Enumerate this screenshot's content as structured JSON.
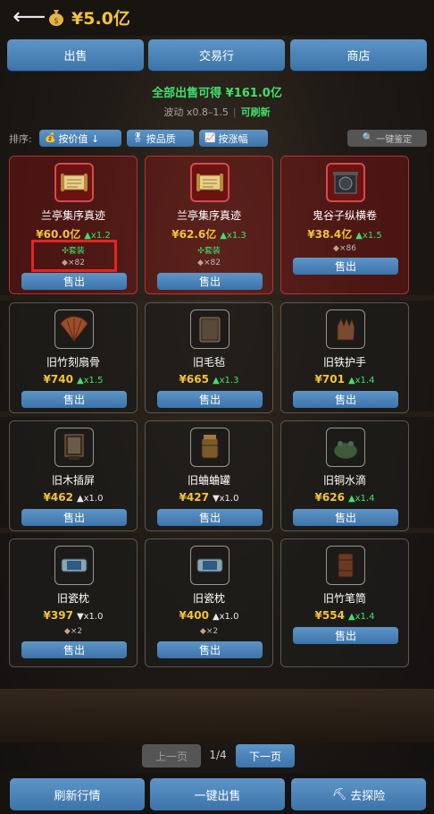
{
  "header": {
    "back_icon": "arrow-left-icon",
    "money_icon": "money-bag-icon",
    "money": "¥5.0亿"
  },
  "tabs": [
    {
      "label": "出售"
    },
    {
      "label": "交易行"
    },
    {
      "label": "商店"
    }
  ],
  "summary": {
    "total": "全部出售可得 ¥161.0亿",
    "fluct": "波动 x0.8–1.5",
    "sep": "|",
    "refresh": "可刷新"
  },
  "sort": {
    "label": "排序:",
    "buttons": [
      {
        "icon": "money-bag-icon",
        "label": "按价值 ↓"
      },
      {
        "icon": "medal-icon",
        "label": "按品质"
      },
      {
        "icon": "trend-chart-icon",
        "label": "按涨幅"
      }
    ],
    "appraise": {
      "icon": "search-icon",
      "label": "一键鉴定"
    }
  },
  "items": [
    {
      "name": "兰亭集序真迹",
      "price": "¥60.0亿",
      "trend": "▲x1.2",
      "dir": "up",
      "set": "套装",
      "count": "×82",
      "style": "red",
      "icon": "scroll"
    },
    {
      "name": "兰亭集序真迹",
      "price": "¥62.6亿",
      "trend": "▲x1.3",
      "dir": "up",
      "set": "套装",
      "count": "×82",
      "style": "red",
      "icon": "scroll"
    },
    {
      "name": "鬼谷子纵横卷",
      "price": "¥38.4亿",
      "trend": "▲x1.5",
      "dir": "up",
      "set": "",
      "count": "×86",
      "style": "red",
      "icon": "dark-scroll"
    },
    {
      "name": "旧竹刻扇骨",
      "price": "¥740",
      "trend": "▲x1.5",
      "dir": "up",
      "set": "",
      "count": "",
      "style": "dark",
      "icon": "fan"
    },
    {
      "name": "旧毛毡",
      "price": "¥665",
      "trend": "▲x1.3",
      "dir": "up",
      "set": "",
      "count": "",
      "style": "dark",
      "icon": "felt"
    },
    {
      "name": "旧铁护手",
      "price": "¥701",
      "trend": "▲x1.4",
      "dir": "up",
      "set": "",
      "count": "",
      "style": "dark",
      "icon": "gauntlet"
    },
    {
      "name": "旧木插屏",
      "price": "¥462",
      "trend": "▲x1.0",
      "dir": "flat",
      "set": "",
      "count": "",
      "style": "dark",
      "icon": "screen"
    },
    {
      "name": "旧蛐蛐罐",
      "price": "¥427",
      "trend": "▼x1.0",
      "dir": "down",
      "set": "",
      "count": "",
      "style": "dark",
      "icon": "jar"
    },
    {
      "name": "旧铜水滴",
      "price": "¥626",
      "trend": "▲x1.4",
      "dir": "up",
      "set": "",
      "count": "",
      "style": "dark",
      "icon": "toad"
    },
    {
      "name": "旧瓷枕",
      "price": "¥397",
      "trend": "▼x1.0",
      "dir": "down",
      "set": "",
      "count": "×2",
      "style": "dark",
      "icon": "pillow"
    },
    {
      "name": "旧瓷枕",
      "price": "¥400",
      "trend": "▲x1.0",
      "dir": "flat",
      "set": "",
      "count": "×2",
      "style": "dark",
      "icon": "pillow"
    },
    {
      "name": "旧竹笔筒",
      "price": "¥554",
      "trend": "▲x1.4",
      "dir": "up",
      "set": "",
      "count": "",
      "style": "dark",
      "icon": "brushpot"
    }
  ],
  "sell_label": "售出",
  "set_icon": "sparkle-icon",
  "count_icon": "shard-icon",
  "pager": {
    "prev": "上一页",
    "page": "1/4",
    "next": "下一页"
  },
  "bottom": [
    {
      "label": "刷新行情"
    },
    {
      "label": "一键出售"
    },
    {
      "icon": "pickaxe-icon",
      "label": "去探险"
    }
  ],
  "colors": {
    "button": "#4a84ba",
    "gold": "#f3c33a",
    "green": "#3ee06b",
    "red_card": "#8c1414"
  }
}
